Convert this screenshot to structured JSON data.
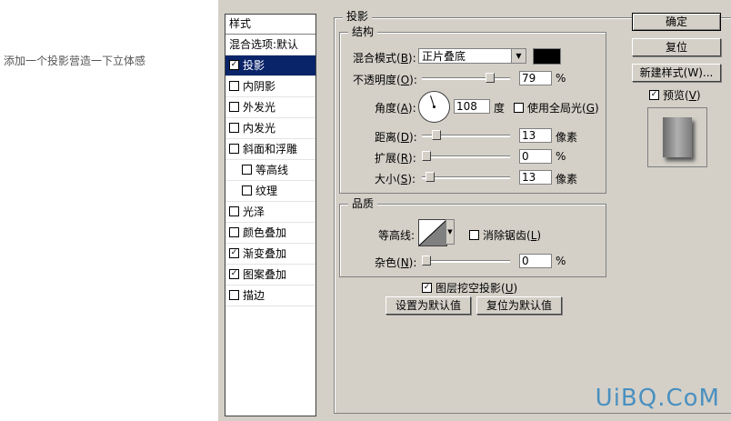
{
  "caption": "添加一个投影营造一下立体感",
  "styles": {
    "header": "样式",
    "blend_default": "混合选项:默认",
    "items": [
      {
        "label": "投影",
        "checked": true,
        "selected": true
      },
      {
        "label": "内阴影",
        "checked": false
      },
      {
        "label": "外发光",
        "checked": false
      },
      {
        "label": "内发光",
        "checked": false
      },
      {
        "label": "斜面和浮雕",
        "checked": false
      },
      {
        "label": "等高线",
        "checked": false
      },
      {
        "label": "纹理",
        "checked": false
      },
      {
        "label": "光泽",
        "checked": false
      },
      {
        "label": "颜色叠加",
        "checked": false
      },
      {
        "label": "渐变叠加",
        "checked": true
      },
      {
        "label": "图案叠加",
        "checked": true
      },
      {
        "label": "描边",
        "checked": false
      }
    ],
    "check_mark": "✓"
  },
  "drop_shadow": {
    "title": "投影",
    "structure": {
      "title": "结构",
      "blend_mode_label": "混合模式(",
      "blend_mode_key": "B",
      "blend_mode_value": "正片叠底",
      "shadow_color": "#000000",
      "opacity_label": "不透明度(",
      "opacity_key": "O",
      "opacity_value": "79",
      "opacity_fraction": 0.79,
      "percent": "%",
      "angle_label": "角度(",
      "angle_key": "A",
      "angle_value": "108",
      "angle_unit": "度",
      "global_light_label": "使用全局光(",
      "global_light_key": "G",
      "global_light_checked": false,
      "distance_label": "距离(",
      "distance_key": "D",
      "distance_value": "13",
      "distance_fraction": 0.13,
      "pixels": "像素",
      "spread_label": "扩展(",
      "spread_key": "R",
      "spread_value": "0",
      "spread_fraction": 0,
      "size_label": "大小(",
      "size_key": "S",
      "size_value": "13",
      "size_fraction": 0.05,
      "paren_close": "):"
    },
    "quality": {
      "title": "品质",
      "contour_label": "等高线:",
      "anti_alias_label": "消除锯齿(",
      "anti_alias_key": "L",
      "anti_alias_checked": false,
      "noise_label": "杂色(",
      "noise_key": "N",
      "noise_value": "0",
      "noise_fraction": 0
    },
    "knockout_label": "图层挖空投影(",
    "knockout_key": "U",
    "knockout_checked": true,
    "make_default": "设置为默认值",
    "reset_default": "复位为默认值"
  },
  "buttons": {
    "ok": "确定",
    "reset": "复位",
    "new_style": "新建样式(W)...",
    "preview_label": "预览(",
    "preview_key": "V",
    "preview_checked": true
  },
  "watermark": "UiBQ.CoM"
}
